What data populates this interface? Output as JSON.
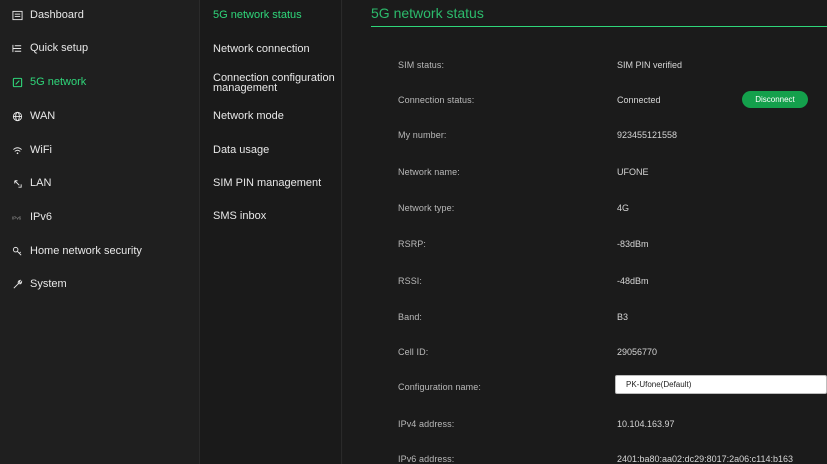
{
  "sidebar": {
    "items": [
      {
        "label": "Dashboard",
        "icon": "dashboard-icon"
      },
      {
        "label": "Quick setup",
        "icon": "quick-setup-icon"
      },
      {
        "label": "5G network",
        "icon": "5g-network-icon"
      },
      {
        "label": "WAN",
        "icon": "globe-icon"
      },
      {
        "label": "WiFi",
        "icon": "wifi-icon"
      },
      {
        "label": "LAN",
        "icon": "lan-icon"
      },
      {
        "label": "IPv6",
        "icon": "ipv6-icon"
      },
      {
        "label": "Home network security",
        "icon": "key-icon"
      },
      {
        "label": "System",
        "icon": "wrench-icon"
      }
    ],
    "active_index": 2
  },
  "submenu": {
    "items": [
      {
        "label": "5G network status"
      },
      {
        "label": "Network connection"
      },
      {
        "label": "Connection configuration management"
      },
      {
        "label": "Network mode"
      },
      {
        "label": "Data usage"
      },
      {
        "label": "SIM PIN management"
      },
      {
        "label": "SMS inbox"
      }
    ],
    "active_index": 0
  },
  "main": {
    "title": "5G network status",
    "rows": {
      "sim_status": {
        "label": "SIM status:",
        "value": "SIM PIN verified"
      },
      "connection_status": {
        "label": "Connection status:",
        "value": "Connected"
      },
      "my_number": {
        "label": "My number:",
        "value": "923455121558"
      },
      "network_name": {
        "label": "Network name:",
        "value": "UFONE"
      },
      "network_type": {
        "label": "Network type:",
        "value": "4G"
      },
      "rsrp": {
        "label": "RSRP:",
        "value": "-83dBm"
      },
      "rssi": {
        "label": "RSSI:",
        "value": "-48dBm"
      },
      "band": {
        "label": "Band:",
        "value": "B3"
      },
      "cell_id": {
        "label": "Cell ID:",
        "value": "29056770"
      },
      "configuration_name": {
        "label": "Configuration name:",
        "value": "PK-Ufone(Default)"
      },
      "ipv4_address": {
        "label": "IPv4 address:",
        "value": "10.104.163.97"
      },
      "ipv6_address": {
        "label": "IPv6 address:",
        "value": "2401:ba80:aa02:dc29:8017:2a06:c114:b163"
      }
    },
    "disconnect_label": "Disconnect"
  },
  "colors": {
    "accent": "#2fd67a",
    "button_green": "#14a04c",
    "background": "#1c1c1c"
  }
}
